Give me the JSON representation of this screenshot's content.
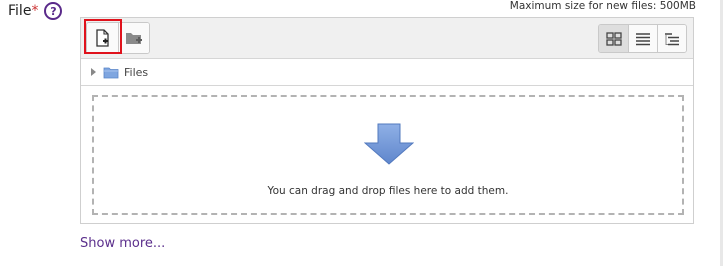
{
  "field": {
    "label": "File",
    "required_mark": "*",
    "help_icon": "question-circle-icon",
    "help_glyph": "?"
  },
  "max_size_text": "Maximum size for new files: 500MB",
  "toolbar": {
    "add_file_icon": "add-file-icon",
    "create_folder_icon": "create-folder-icon",
    "view_modes": [
      {
        "icon": "icon-view-icon",
        "active": true
      },
      {
        "icon": "list-view-icon",
        "active": false
      },
      {
        "icon": "tree-view-icon",
        "active": false
      }
    ]
  },
  "path": {
    "folder_label": "Files"
  },
  "dropzone": {
    "text": "You can drag and drop files here to add them.",
    "icon": "down-arrow-icon"
  },
  "show_more": "Show more...",
  "colors": {
    "required": "#cc3333",
    "link": "#5b2f8c",
    "highlight": "#e0121c",
    "arrow": "#6f95d6"
  }
}
